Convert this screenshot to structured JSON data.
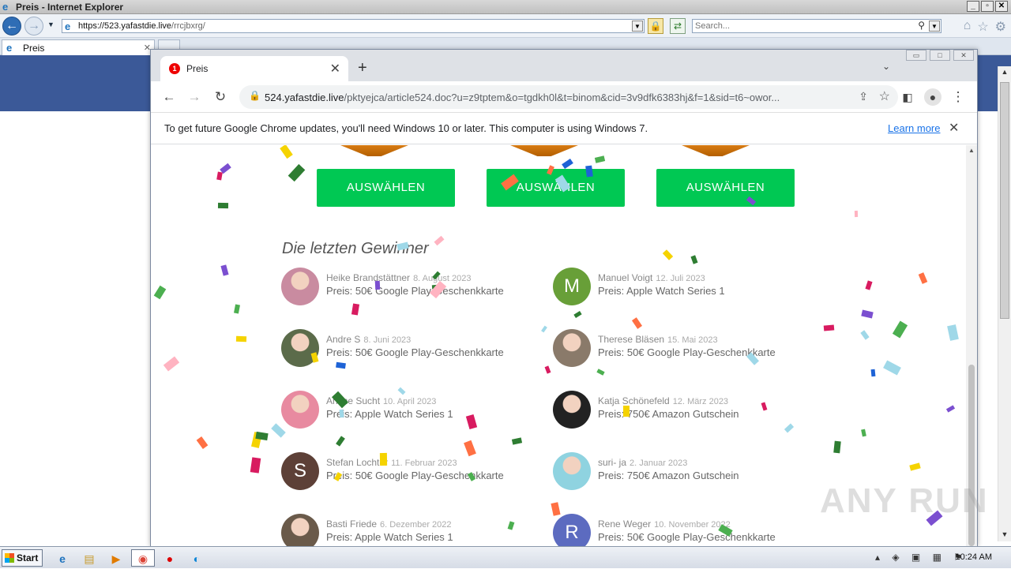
{
  "ie": {
    "title": "Preis - Internet Explorer",
    "address_host": "https://523.yafastdie.live",
    "address_path": "/rrcjbxrg/",
    "search_placeholder": "Search...",
    "tab_label": "Preis"
  },
  "chrome": {
    "tab_label": "Preis",
    "tab_badge": "1",
    "url_host": "524.yafastdie.live",
    "url_path": "/pktyejca/article524.doc?u=z9tptem&o=tgdkh0l&t=binom&cid=3v9dfk6383hj&f=1&sid=t6~owor...",
    "infobar_message": "To get future Google Chrome updates, you'll need Windows 10 or later. This computer is using Windows 7.",
    "infobar_link": "Learn more"
  },
  "page": {
    "select_buttons": [
      "AUSWÄHLEN",
      "AUSWÄHLEN",
      "AUSWÄHLEN"
    ],
    "winners_heading": "Die letzten Gewinner",
    "winners": [
      {
        "name": "Heike Brandstättner",
        "date": "8. August 2023",
        "prize": "Preis: 50€ Google Play-Geschenkkarte",
        "avatar": "photo",
        "color": "#c98ba0"
      },
      {
        "name": "Manuel Voigt",
        "date": "12. Juli 2023",
        "prize": "Preis: Apple Watch Series 1",
        "avatar": "M",
        "color": "#689f38"
      },
      {
        "name": "Andre S",
        "date": "8. Juni 2023",
        "prize": "Preis: 50€ Google Play-Geschenkkarte",
        "avatar": "photo",
        "color": "#5b6b4a"
      },
      {
        "name": "Therese Bläsen",
        "date": "15. Mai 2023",
        "prize": "Preis: 50€ Google Play-Geschenkkarte",
        "avatar": "photo",
        "color": "#8a7a6a"
      },
      {
        "name": "Anime Sucht",
        "date": "10. April 2023",
        "prize": "Preis: Apple Watch Series 1",
        "avatar": "photo",
        "color": "#e88aa0"
      },
      {
        "name": "Katja Schönefeld",
        "date": "12. März 2023",
        "prize": "Preis: 750€ Amazon Gutschein",
        "avatar": "photo",
        "color": "#222222"
      },
      {
        "name": "Stefan Lochter",
        "date": "11. Februar 2023",
        "prize": "Preis: 50€ Google Play-Geschenkkarte",
        "avatar": "S",
        "color": "#5d4037"
      },
      {
        "name": "suri- ja",
        "date": "2. Januar 2023",
        "prize": "Preis: 750€ Amazon Gutschein",
        "avatar": "photo",
        "color": "#8fd3e0"
      },
      {
        "name": "Basti Friede",
        "date": "6. Dezember 2022",
        "prize": "Preis: Apple Watch Series 1",
        "avatar": "photo",
        "color": "#6a5a4a"
      },
      {
        "name": "Rene Weger",
        "date": "10. November 2022",
        "prize": "Preis: 50€ Google Play-Geschenkkarte",
        "avatar": "R",
        "color": "#5c6bc0"
      }
    ]
  },
  "watermark": "ANY RUN",
  "taskbar": {
    "start_label": "Start",
    "clock": "10:24 AM"
  },
  "colors": {
    "button_green": "#00c853",
    "banner_blue": "#3b5998",
    "confetti": [
      "#f5d300",
      "#1e63d6",
      "#d81b60",
      "#4caf50",
      "#ff7043",
      "#9fd8e8",
      "#7b4fd0",
      "#ffb3c1",
      "#2e7d32"
    ]
  }
}
